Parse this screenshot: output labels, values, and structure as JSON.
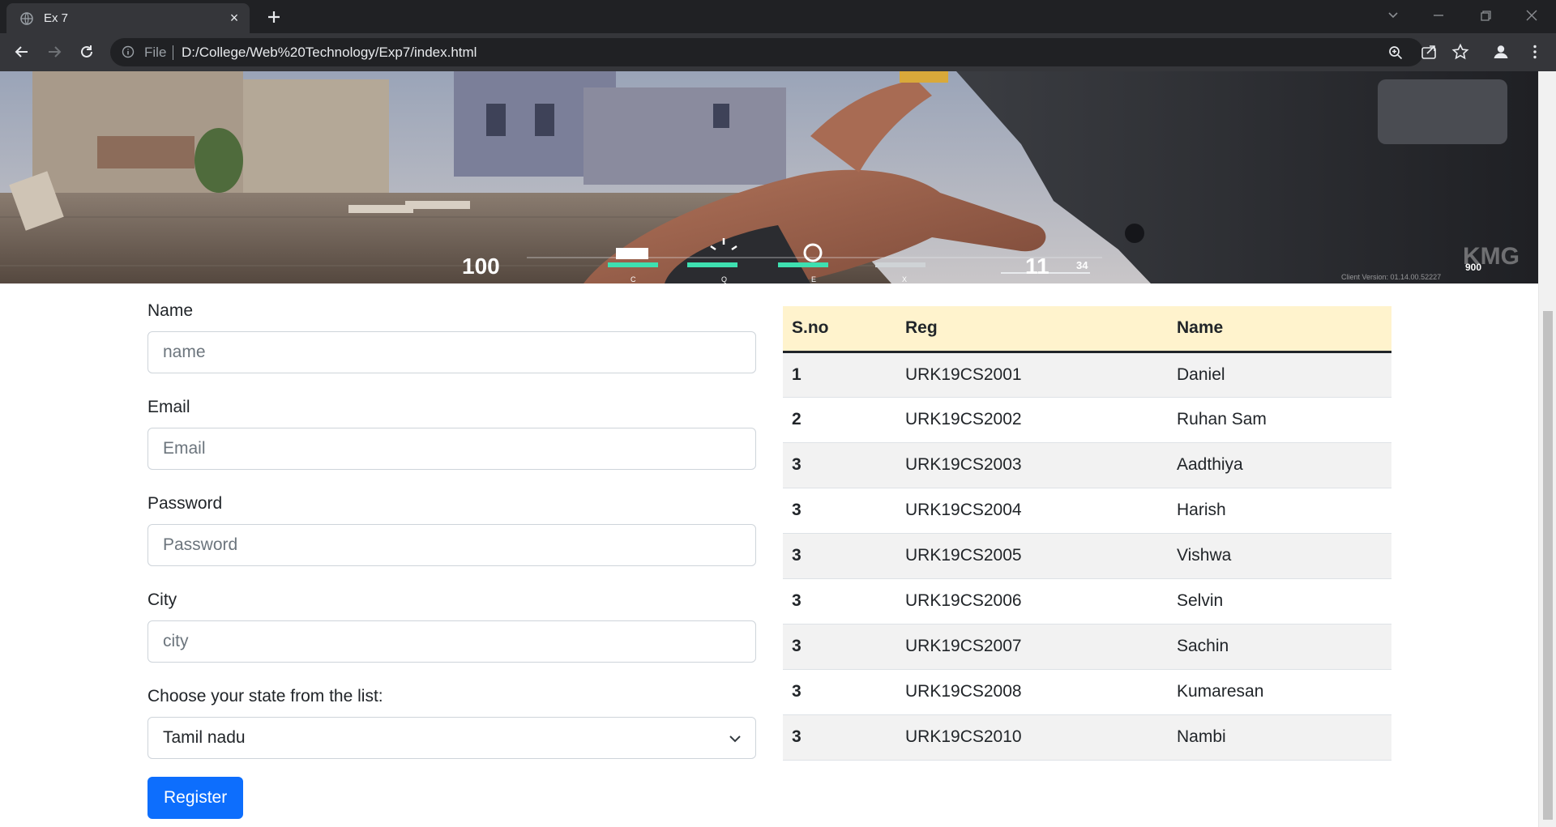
{
  "browser": {
    "tab_title": "Ex 7",
    "address_scheme": "File",
    "address_url": "D:/College/Web%20Technology/Exp7/index.html"
  },
  "banner": {
    "hud_health": "100",
    "hud_ammo": "11",
    "hud_reserve": "34",
    "hud_ability_keys": [
      "C",
      "Q",
      "E",
      "X"
    ],
    "hud_credits": "900",
    "watermark": "KMG",
    "client_version_label": "Client Version: 01.14.00.52227"
  },
  "form": {
    "name_label": "Name",
    "name_placeholder": "name",
    "email_label": "Email",
    "email_placeholder": "Email",
    "password_label": "Password",
    "password_placeholder": "Password",
    "city_label": "City",
    "city_placeholder": "city",
    "state_label": "Choose your state from the list:",
    "state_selected": "Tamil nadu",
    "register_label": "Register"
  },
  "table": {
    "headers": [
      "S.no",
      "Reg",
      "Name"
    ],
    "rows": [
      [
        "1",
        "URK19CS2001",
        "Daniel"
      ],
      [
        "2",
        "URK19CS2002",
        "Ruhan Sam"
      ],
      [
        "3",
        "URK19CS2003",
        "Aadthiya"
      ],
      [
        "3",
        "URK19CS2004",
        "Harish"
      ],
      [
        "3",
        "URK19CS2005",
        "Vishwa"
      ],
      [
        "3",
        "URK19CS2006",
        "Selvin"
      ],
      [
        "3",
        "URK19CS2007",
        "Sachin"
      ],
      [
        "3",
        "URK19CS2008",
        "Kumaresan"
      ],
      [
        "3",
        "URK19CS2010",
        "Nambi"
      ]
    ],
    "header_bg": "#fff3cd",
    "stripe_bg": "#f2f2f2"
  },
  "colors": {
    "primary": "#0d6efd",
    "chrome_dark": "#202124",
    "chrome_mid": "#35363a"
  },
  "icons": {
    "tab": "globe-icon",
    "address": "info-icon",
    "toolbar": [
      "zoom-icon",
      "share-icon",
      "star-icon",
      "profile-icon",
      "menu-icon"
    ]
  }
}
